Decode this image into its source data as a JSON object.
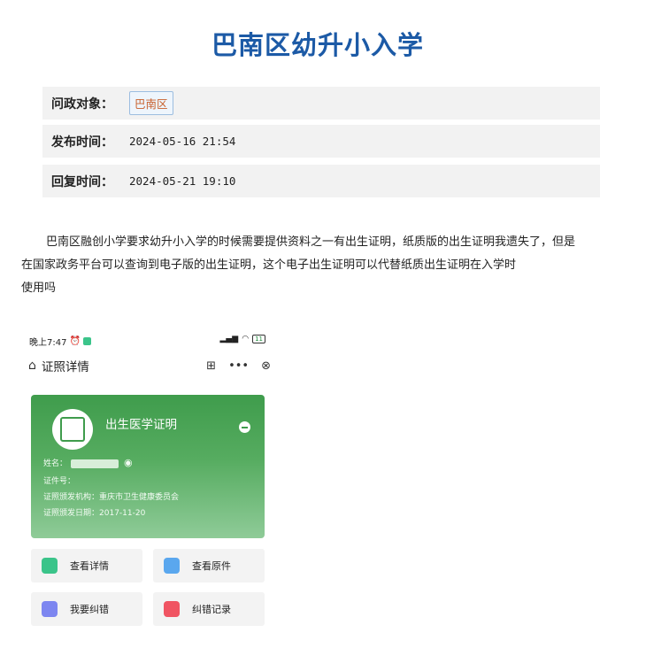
{
  "header": {
    "title": "巴南区幼升小入学"
  },
  "meta": {
    "target_label": "问政对象：",
    "target_tag": "巴南区",
    "published_label": "发布时间：",
    "published_value": "2024-05-16 21:54",
    "replied_label": "回复时间：",
    "replied_value": "2024-05-21 19:10"
  },
  "question": {
    "line1": "巴南区融创小学要求幼升小入学的时候需要提供资料之一有出生证明，纸质版的出生证明我遗失了，但是",
    "line2": "在国家政务平台可以查询到电子版的出生证明，这个电子出生证明可以代替纸质出生证明在入学时",
    "line3": "使用吗"
  },
  "phone": {
    "status_time": "晚上7:47",
    "battery": "11",
    "app_title": "证照详情",
    "card": {
      "title": "出生医学证明",
      "name_label": "姓名：",
      "id_label": "证件号：",
      "issuer_label": "证照颁发机构：",
      "issuer_value": "重庆市卫生健康委员会",
      "date_label": "证照颁发日期：",
      "date_value": "2017-11-20"
    },
    "actions": [
      {
        "label": "查看详情",
        "color": "#3bc48a"
      },
      {
        "label": "查看原件",
        "color": "#5aa7ee"
      },
      {
        "label": "我要纠错",
        "color": "#7d86f0"
      },
      {
        "label": "纠错记录",
        "color": "#f05462"
      }
    ]
  }
}
